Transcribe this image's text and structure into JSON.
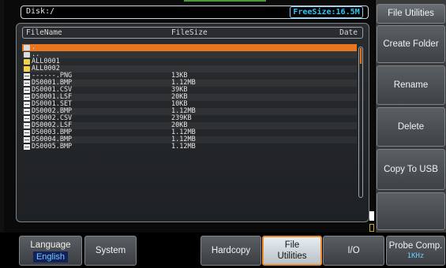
{
  "path_bar": {
    "path": "Disk:/",
    "free_size": "FreeSize:16.5M"
  },
  "file_list": {
    "columns": {
      "name": "FileName",
      "size": "FileSize",
      "date": "Date"
    },
    "rows": [
      {
        "icon": "folder-up-icon",
        "name": ".",
        "size": ""
      },
      {
        "icon": "folder-up-icon",
        "name": "..",
        "size": ""
      },
      {
        "icon": "folder-icon",
        "name": "ALL0001",
        "size": ""
      },
      {
        "icon": "folder-icon",
        "name": "ALL0002",
        "size": ""
      },
      {
        "icon": "file-icon",
        "name": "------.PNG",
        "size": "13KB"
      },
      {
        "icon": "file-icon",
        "name": "DS0001.BMP",
        "size": "1.12MB"
      },
      {
        "icon": "file-icon",
        "name": "DS0001.CSV",
        "size": "39KB"
      },
      {
        "icon": "file-icon",
        "name": "DS0001.LSF",
        "size": "20KB"
      },
      {
        "icon": "file-icon",
        "name": "DS0001.SET",
        "size": "10KB"
      },
      {
        "icon": "file-icon",
        "name": "DS0002.BMP",
        "size": "1.12MB"
      },
      {
        "icon": "file-icon",
        "name": "DS0002.CSV",
        "size": "239KB"
      },
      {
        "icon": "file-icon",
        "name": "DS0002.LSF",
        "size": "20KB"
      },
      {
        "icon": "file-icon",
        "name": "DS0003.BMP",
        "size": "1.12MB"
      },
      {
        "icon": "file-icon",
        "name": "DS0004.BMP",
        "size": "1.12MB"
      },
      {
        "icon": "file-icon",
        "name": "DS0005.BMP",
        "size": "1.12MB"
      }
    ],
    "selected_index": 0
  },
  "side_menu": {
    "title": "File Utilities",
    "items": [
      {
        "label": "Create Folder"
      },
      {
        "label": "Rename"
      },
      {
        "label": "Delete"
      },
      {
        "label": "Copy To USB"
      },
      {
        "label": ""
      }
    ]
  },
  "bottom_menu": {
    "language": {
      "label": "Language",
      "value": "English"
    },
    "system": "System",
    "hardcopy": "Hardcopy",
    "file_utilities": "File Utilities",
    "io": "I/O",
    "probe_comp": {
      "label": "Probe Comp.",
      "value": "1KHz"
    }
  },
  "colors": {
    "accent_orange": "#e8761e",
    "cyan": "#34c6f5",
    "folder_yellow": "#f0d24a"
  }
}
